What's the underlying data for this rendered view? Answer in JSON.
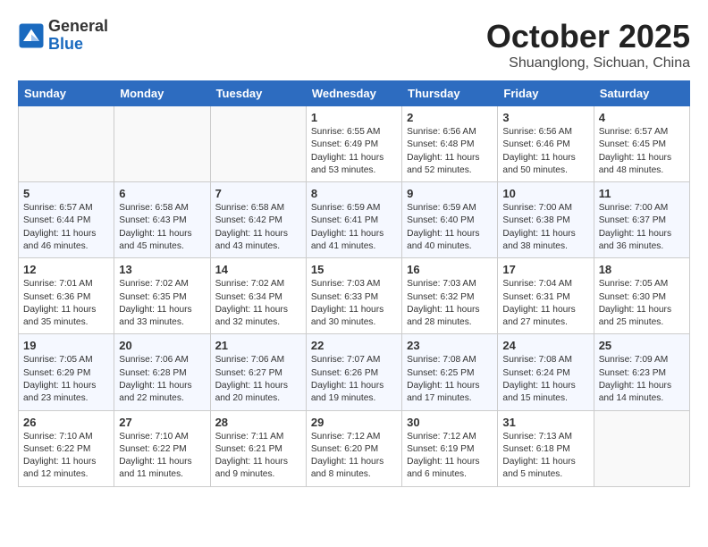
{
  "header": {
    "logo_general": "General",
    "logo_blue": "Blue",
    "month_title": "October 2025",
    "location": "Shuanglong, Sichuan, China"
  },
  "weekdays": [
    "Sunday",
    "Monday",
    "Tuesday",
    "Wednesday",
    "Thursday",
    "Friday",
    "Saturday"
  ],
  "weeks": [
    [
      {
        "day": "",
        "info": ""
      },
      {
        "day": "",
        "info": ""
      },
      {
        "day": "",
        "info": ""
      },
      {
        "day": "1",
        "info": "Sunrise: 6:55 AM\nSunset: 6:49 PM\nDaylight: 11 hours\nand 53 minutes."
      },
      {
        "day": "2",
        "info": "Sunrise: 6:56 AM\nSunset: 6:48 PM\nDaylight: 11 hours\nand 52 minutes."
      },
      {
        "day": "3",
        "info": "Sunrise: 6:56 AM\nSunset: 6:46 PM\nDaylight: 11 hours\nand 50 minutes."
      },
      {
        "day": "4",
        "info": "Sunrise: 6:57 AM\nSunset: 6:45 PM\nDaylight: 11 hours\nand 48 minutes."
      }
    ],
    [
      {
        "day": "5",
        "info": "Sunrise: 6:57 AM\nSunset: 6:44 PM\nDaylight: 11 hours\nand 46 minutes."
      },
      {
        "day": "6",
        "info": "Sunrise: 6:58 AM\nSunset: 6:43 PM\nDaylight: 11 hours\nand 45 minutes."
      },
      {
        "day": "7",
        "info": "Sunrise: 6:58 AM\nSunset: 6:42 PM\nDaylight: 11 hours\nand 43 minutes."
      },
      {
        "day": "8",
        "info": "Sunrise: 6:59 AM\nSunset: 6:41 PM\nDaylight: 11 hours\nand 41 minutes."
      },
      {
        "day": "9",
        "info": "Sunrise: 6:59 AM\nSunset: 6:40 PM\nDaylight: 11 hours\nand 40 minutes."
      },
      {
        "day": "10",
        "info": "Sunrise: 7:00 AM\nSunset: 6:38 PM\nDaylight: 11 hours\nand 38 minutes."
      },
      {
        "day": "11",
        "info": "Sunrise: 7:00 AM\nSunset: 6:37 PM\nDaylight: 11 hours\nand 36 minutes."
      }
    ],
    [
      {
        "day": "12",
        "info": "Sunrise: 7:01 AM\nSunset: 6:36 PM\nDaylight: 11 hours\nand 35 minutes."
      },
      {
        "day": "13",
        "info": "Sunrise: 7:02 AM\nSunset: 6:35 PM\nDaylight: 11 hours\nand 33 minutes."
      },
      {
        "day": "14",
        "info": "Sunrise: 7:02 AM\nSunset: 6:34 PM\nDaylight: 11 hours\nand 32 minutes."
      },
      {
        "day": "15",
        "info": "Sunrise: 7:03 AM\nSunset: 6:33 PM\nDaylight: 11 hours\nand 30 minutes."
      },
      {
        "day": "16",
        "info": "Sunrise: 7:03 AM\nSunset: 6:32 PM\nDaylight: 11 hours\nand 28 minutes."
      },
      {
        "day": "17",
        "info": "Sunrise: 7:04 AM\nSunset: 6:31 PM\nDaylight: 11 hours\nand 27 minutes."
      },
      {
        "day": "18",
        "info": "Sunrise: 7:05 AM\nSunset: 6:30 PM\nDaylight: 11 hours\nand 25 minutes."
      }
    ],
    [
      {
        "day": "19",
        "info": "Sunrise: 7:05 AM\nSunset: 6:29 PM\nDaylight: 11 hours\nand 23 minutes."
      },
      {
        "day": "20",
        "info": "Sunrise: 7:06 AM\nSunset: 6:28 PM\nDaylight: 11 hours\nand 22 minutes."
      },
      {
        "day": "21",
        "info": "Sunrise: 7:06 AM\nSunset: 6:27 PM\nDaylight: 11 hours\nand 20 minutes."
      },
      {
        "day": "22",
        "info": "Sunrise: 7:07 AM\nSunset: 6:26 PM\nDaylight: 11 hours\nand 19 minutes."
      },
      {
        "day": "23",
        "info": "Sunrise: 7:08 AM\nSunset: 6:25 PM\nDaylight: 11 hours\nand 17 minutes."
      },
      {
        "day": "24",
        "info": "Sunrise: 7:08 AM\nSunset: 6:24 PM\nDaylight: 11 hours\nand 15 minutes."
      },
      {
        "day": "25",
        "info": "Sunrise: 7:09 AM\nSunset: 6:23 PM\nDaylight: 11 hours\nand 14 minutes."
      }
    ],
    [
      {
        "day": "26",
        "info": "Sunrise: 7:10 AM\nSunset: 6:22 PM\nDaylight: 11 hours\nand 12 minutes."
      },
      {
        "day": "27",
        "info": "Sunrise: 7:10 AM\nSunset: 6:22 PM\nDaylight: 11 hours\nand 11 minutes."
      },
      {
        "day": "28",
        "info": "Sunrise: 7:11 AM\nSunset: 6:21 PM\nDaylight: 11 hours\nand 9 minutes."
      },
      {
        "day": "29",
        "info": "Sunrise: 7:12 AM\nSunset: 6:20 PM\nDaylight: 11 hours\nand 8 minutes."
      },
      {
        "day": "30",
        "info": "Sunrise: 7:12 AM\nSunset: 6:19 PM\nDaylight: 11 hours\nand 6 minutes."
      },
      {
        "day": "31",
        "info": "Sunrise: 7:13 AM\nSunset: 6:18 PM\nDaylight: 11 hours\nand 5 minutes."
      },
      {
        "day": "",
        "info": ""
      }
    ]
  ]
}
